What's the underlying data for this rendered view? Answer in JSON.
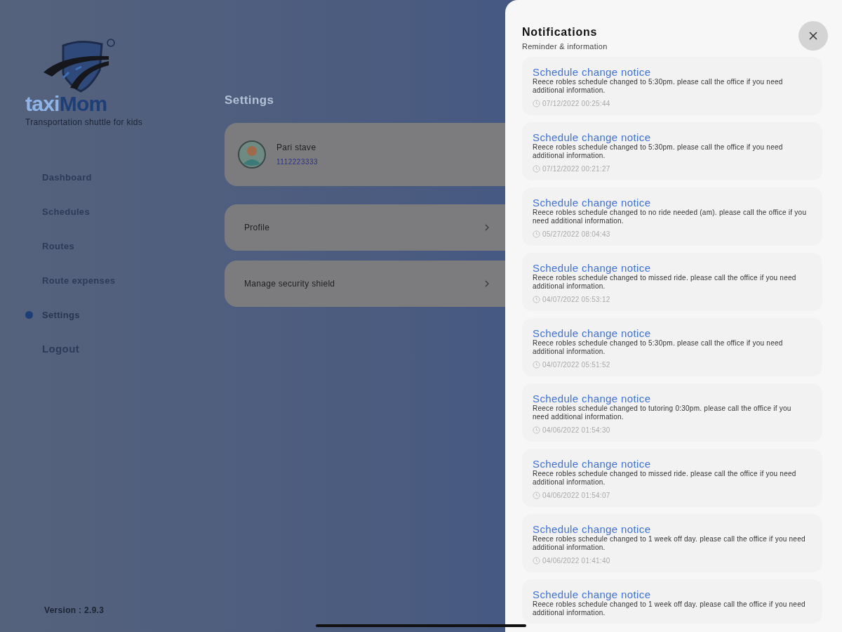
{
  "brand": {
    "name_light": "taxi",
    "name_dark": "Mom",
    "tagline": "Transportation shuttle for kids"
  },
  "sidebar": {
    "items": [
      {
        "label": "Dashboard",
        "selected": false
      },
      {
        "label": "Schedules",
        "selected": false
      },
      {
        "label": "Routes",
        "selected": false
      },
      {
        "label": "Route expenses",
        "selected": false
      },
      {
        "label": "Settings",
        "selected": true
      },
      {
        "label": "Logout",
        "selected": false
      }
    ],
    "version": "Version : 2.9.3"
  },
  "settings": {
    "title": "Settings",
    "user": {
      "name": "Pari stave",
      "phone": "1112223333"
    },
    "rows": [
      "Profile",
      "Manage security shield"
    ]
  },
  "notifications": {
    "title": "Notifications",
    "subtitle": "Reminder & information",
    "items": [
      {
        "title": "Schedule change notice",
        "body": "Reece robles schedule changed to 5:30pm.  please call the office if you need additional information.",
        "time": "07/12/2022 00:25:44"
      },
      {
        "title": "Schedule change notice",
        "body": "Reece robles schedule changed to 5:30pm.  please call the office if you need additional information.",
        "time": "07/12/2022 00:21:27"
      },
      {
        "title": "Schedule change notice",
        "body": "Reece robles schedule changed to no ride needed (am).  please call the office if you need additional information.",
        "time": "05/27/2022 08:04:43"
      },
      {
        "title": "Schedule change notice",
        "body": "Reece robles schedule changed to missed ride.  please call the office if you need additional information.",
        "time": "04/07/2022 05:53:12"
      },
      {
        "title": "Schedule change notice",
        "body": "Reece robles schedule changed to 5:30pm.  please call the office if you need additional information.",
        "time": "04/07/2022 05:51:52"
      },
      {
        "title": "Schedule change notice",
        "body": "Reece robles schedule changed to tutoring 0:30pm.  please call the office if you need additional information.",
        "time": "04/06/2022 01:54:30"
      },
      {
        "title": "Schedule change notice",
        "body": "Reece robles schedule changed to missed ride.  please call the office if you need additional information.",
        "time": "04/06/2022 01:54:07"
      },
      {
        "title": "Schedule change notice",
        "body": "Reece robles schedule changed to 1 week off day.  please call the office if you need additional information.",
        "time": "04/06/2022 01:41:40"
      },
      {
        "title": "Schedule change notice",
        "body": "Reece robles schedule changed to 1 week off day.  please call the office if you need additional information."
      }
    ]
  }
}
